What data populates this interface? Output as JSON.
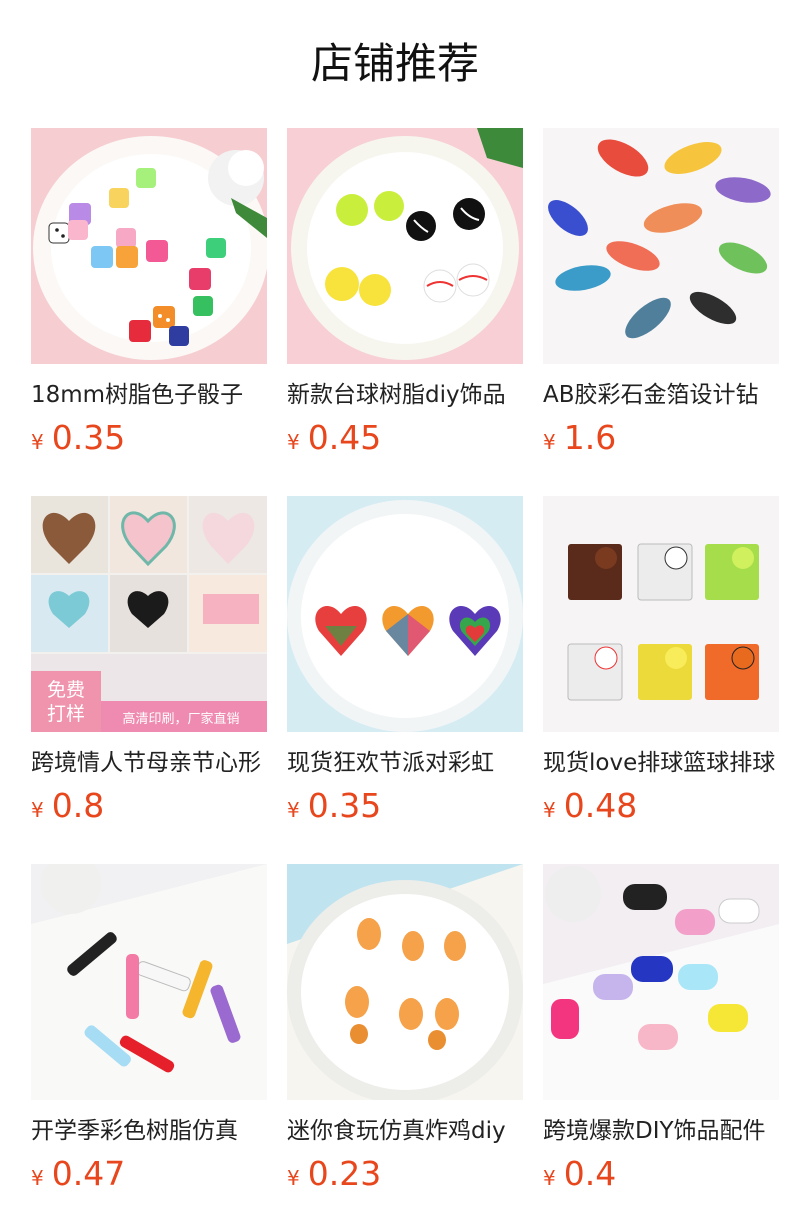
{
  "header": {
    "title": "店铺推荐"
  },
  "currency_symbol": "¥",
  "colors": {
    "price": "#e8461c",
    "title": "#222222",
    "heading": "#111111"
  },
  "products": [
    {
      "title": "18mm树脂色子骰子",
      "price": "0.35",
      "image": "dice-charms"
    },
    {
      "title": "新款台球树脂diy饰品",
      "price": "0.45",
      "image": "sports-ball-charms"
    },
    {
      "title": "AB胶彩石金箔设计钻",
      "price": "1.6",
      "image": "koi-fish-charms"
    },
    {
      "title": "跨境情人节母亲节心形",
      "price": "0.8",
      "image": "heart-acrylic-collage",
      "badge": {
        "text": "免费\n打样",
        "banner": "高清印刷，厂家直销"
      }
    },
    {
      "title": "现货狂欢节派对彩虹",
      "price": "0.35",
      "image": "rainbow-heart-charms"
    },
    {
      "title": "现货love排球篮球排球",
      "price": "0.48",
      "image": "love-sports-charms"
    },
    {
      "title": "开学季彩色树脂仿真",
      "price": "0.47",
      "image": "pencil-charms"
    },
    {
      "title": "迷你食玩仿真炸鸡diy",
      "price": "0.23",
      "image": "fried-chicken-charms"
    },
    {
      "title": "跨境爆款DIY饰品配件",
      "price": "0.4",
      "image": "gamepad-charms"
    }
  ]
}
